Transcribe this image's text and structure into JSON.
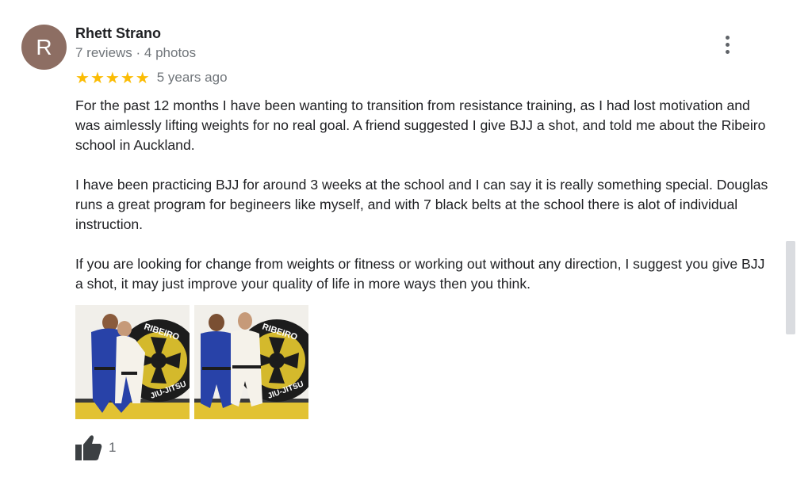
{
  "reviewer": {
    "avatar_letter": "R",
    "name": "Rhett Strano",
    "meta": "7 reviews · 4 photos"
  },
  "rating": {
    "stars": 5,
    "time_ago": "5 years ago"
  },
  "review": {
    "paragraphs": [
      "For the past 12 months I have been wanting to transition from resistance training, as I had lost motivation and was aimlessly lifting weights for no real goal. A friend suggested I give BJJ a shot, and told me about the Ribeiro school in Auckland.",
      "I have been practicing BJJ for around 3 weeks at the school and I can say it is really something special. Douglas runs a great program for begineers like myself, and with 7 black belts at the school there is alot of individual instruction.",
      "If you are looking for change from weights or fitness or working out without any direction, I suggest you give BJJ a shot, it may just improve your quality of life in more ways then you think."
    ]
  },
  "photos": {
    "logo_text": "RIBEIRO",
    "logo_bottom_text": "JIU-JITSU"
  },
  "likes": {
    "count": "1"
  },
  "colors": {
    "star": "#fbbc04",
    "avatar_bg": "#8d6e63",
    "secondary_text": "#70757a"
  },
  "icons": {
    "more": "more-vert-icon",
    "like": "thumb-up-icon",
    "star": "star-icon"
  }
}
